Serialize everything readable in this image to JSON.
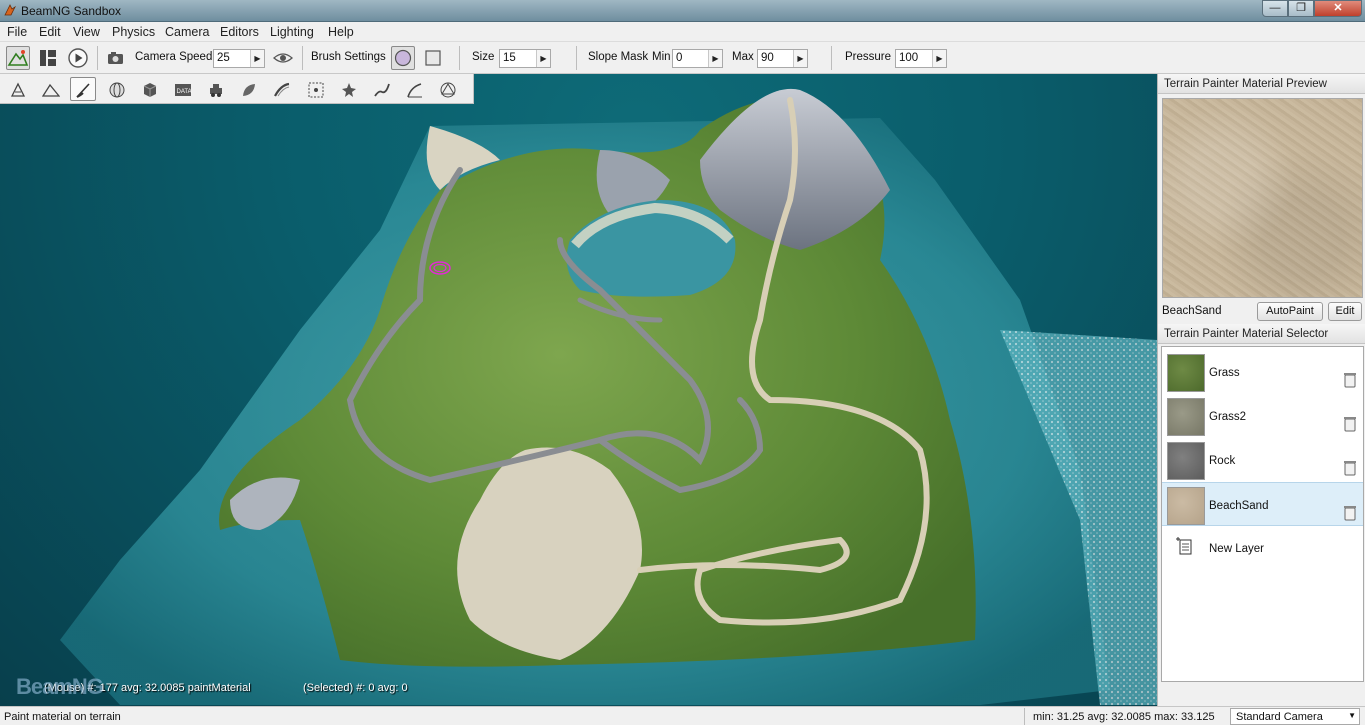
{
  "window": {
    "title": "BeamNG Sandbox",
    "minimize": "—",
    "maximize": "❐",
    "close": "✕"
  },
  "menu": [
    "File",
    "Edit",
    "View",
    "Physics",
    "Camera",
    "Editors",
    "Lighting",
    "Help"
  ],
  "toolbar": {
    "camera_speed_label": "Camera Speed",
    "camera_speed_value": "25",
    "brush_settings_label": "Brush Settings",
    "size_label": "Size",
    "size_value": "15",
    "slope_mask_label": "Slope Mask",
    "min_label": "Min",
    "min_value": "0",
    "max_label": "Max",
    "max_value": "90",
    "pressure_label": "Pressure",
    "pressure_value": "100"
  },
  "viewport": {
    "mouse_info": "(Mouse) #: 177  avg: 32.0085 paintMaterial",
    "selected_info": "(Selected) #: 0  avg: 0",
    "logo": "BeamNG"
  },
  "preview": {
    "header": "Terrain Painter Material Preview",
    "material_name": "BeachSand",
    "autopaint_label": "AutoPaint",
    "edit_label": "Edit"
  },
  "selector": {
    "header": "Terrain Painter Material Selector",
    "materials": [
      {
        "label": "Grass",
        "color": "#5f7a3c"
      },
      {
        "label": "Grass2",
        "color": "#8a8a78"
      },
      {
        "label": "Rock",
        "color": "#6f6f6f"
      },
      {
        "label": "BeachSand",
        "color": "#c2b098"
      }
    ],
    "new_layer_label": "New Layer"
  },
  "status": {
    "message": "Paint material on terrain",
    "stats": "min: 31.25  avg: 32.0085  max: 33.125",
    "camera_mode": "Standard Camera"
  },
  "colors": {
    "selection": "#ddeef9",
    "water": "#0a5d6b"
  }
}
